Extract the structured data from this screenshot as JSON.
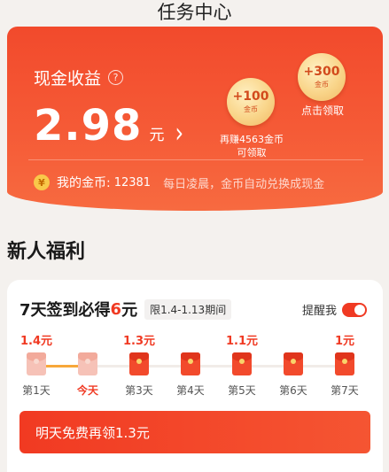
{
  "header": {
    "title": "任务中心"
  },
  "hero": {
    "label": "现金收益",
    "help_glyph": "?",
    "amount": "2.98",
    "unit": "元",
    "chevron": "›",
    "coin_small": {
      "value": "+100",
      "unit": "金币",
      "caption_line1": "再赚4563金币",
      "caption_line2": "可领取"
    },
    "coin_big": {
      "value": "+300",
      "unit": "金币",
      "caption": "点击领取"
    },
    "coin_icon": "¥",
    "coins_label": "我的金币:",
    "coins_count": "12381",
    "coins_tip": "每日凌晨，金币自动兑换成现金"
  },
  "section": {
    "title": "新人福利"
  },
  "signin": {
    "title_prefix": "7天签到必得",
    "title_amount": "6",
    "title_suffix": "元",
    "period": "限1.4-1.13期间",
    "remind_label": "提醒我",
    "remind_on": true,
    "days": [
      {
        "amount": "1.4元",
        "label": "第1天",
        "state": "past"
      },
      {
        "amount": "",
        "label": "今天",
        "state": "today"
      },
      {
        "amount": "1.3元",
        "label": "第3天",
        "state": "future"
      },
      {
        "amount": "",
        "label": "第4天",
        "state": "future"
      },
      {
        "amount": "1.1元",
        "label": "第5天",
        "state": "future"
      },
      {
        "amount": "",
        "label": "第6天",
        "state": "future"
      },
      {
        "amount": "1元",
        "label": "第7天",
        "state": "future"
      }
    ],
    "cta": "明天免费再领1.3元"
  },
  "colors": {
    "accent": "#f03a23",
    "hero": "#f24a2c",
    "gold": "#f9d58a"
  }
}
